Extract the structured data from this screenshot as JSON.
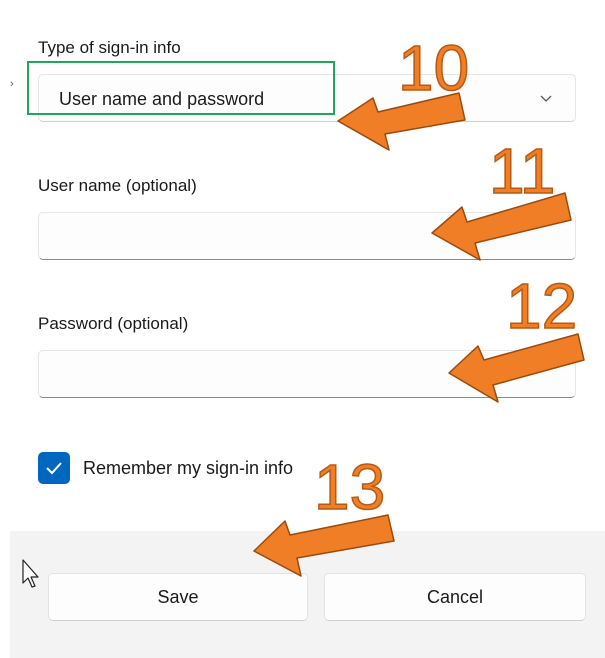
{
  "sign_in_type": {
    "label": "Type of sign-in info",
    "selected": "User name and password",
    "chevron_icon": "chevron-down-icon"
  },
  "username": {
    "label": "User name (optional)",
    "value": "",
    "placeholder": ""
  },
  "password": {
    "label": "Password (optional)",
    "value": "",
    "placeholder": ""
  },
  "remember": {
    "label": "Remember my sign-in info",
    "checked": true
  },
  "footer": {
    "save_label": "Save",
    "cancel_label": "Cancel"
  },
  "annotations": {
    "step_10": "10",
    "step_11": "11",
    "step_12": "12",
    "step_13": "13"
  },
  "colors": {
    "accent": "#0067c0",
    "highlight": "#22a65a",
    "annotation_arrow": "#f07e26",
    "footer_background": "#f3f3f3"
  },
  "misc": {
    "tiny_mark": "›",
    "cursor_icon": "mouse-pointer-icon"
  }
}
